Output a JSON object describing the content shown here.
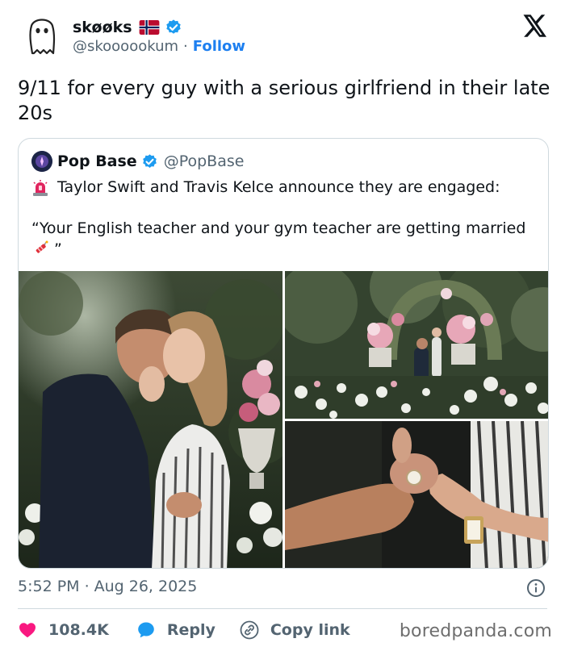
{
  "author": {
    "display_name": "skøøks",
    "handle": "@skoooookum",
    "separator": "·",
    "follow_label": "Follow",
    "flag_icon": "norway-flag-icon",
    "verified_icon": "verified-badge-icon"
  },
  "tweet": {
    "text": "9/11 for every guy with a serious girlfriend in their late 20s"
  },
  "quoted_tweet": {
    "display_name": "Pop Base",
    "handle": "@PopBase",
    "line1": "Taylor Swift and Travis Kelce announce they are engaged:",
    "quote_text": "“Your English teacher and your gym teacher are getting married",
    "quote_close": " ”",
    "images": [
      "embrace-photo",
      "garden-proposal-photo",
      "hands-ring-photo"
    ]
  },
  "meta": {
    "time": "5:52 PM",
    "separator": "·",
    "date": "Aug 26, 2025"
  },
  "actions": {
    "like_count": "108.4K",
    "reply_label": "Reply",
    "copy_link_label": "Copy link"
  },
  "watermark": "boredpanda.com",
  "colors": {
    "accent": "#1d9bf0",
    "like": "#f91880",
    "text": "#0f1419",
    "muted": "#536471"
  }
}
